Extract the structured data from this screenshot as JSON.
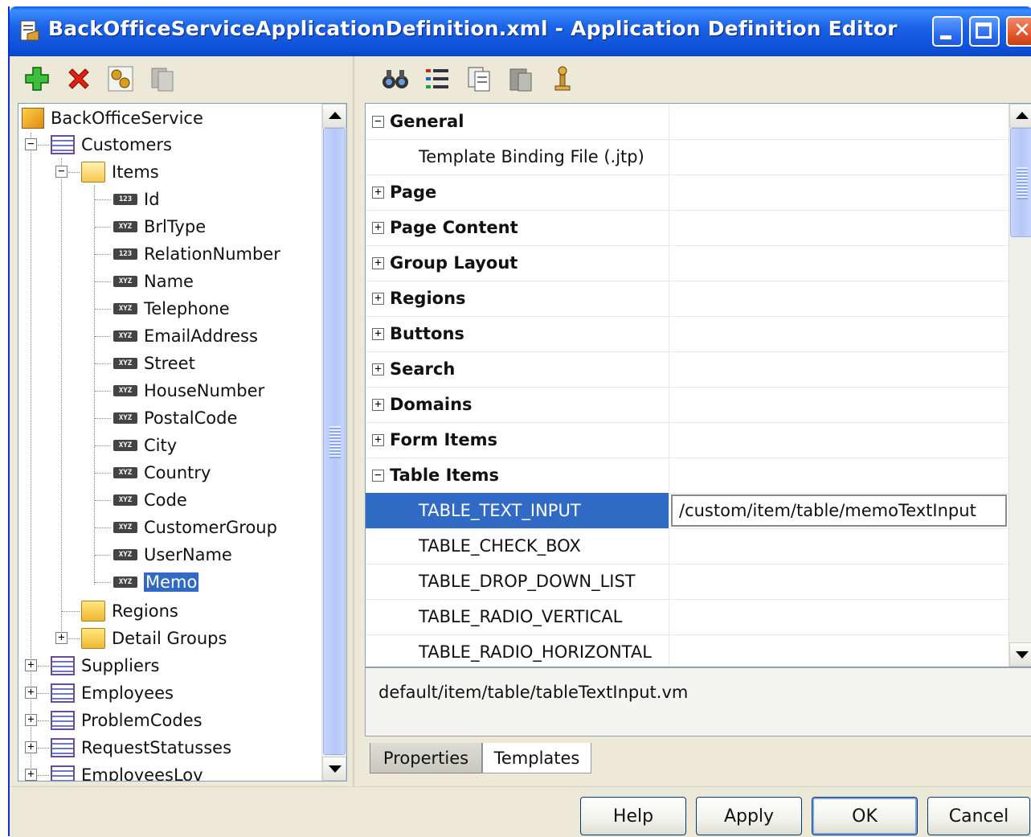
{
  "window": {
    "title": "BackOfficeServiceApplicationDefinition.xml - Application Definition Editor"
  },
  "left_toolbar": {
    "icons": [
      "add-icon",
      "delete-icon",
      "generate-icon",
      "copy-icon"
    ]
  },
  "right_toolbar": {
    "icons": [
      "find-icon",
      "list-icon",
      "copy-icon",
      "paste-icon",
      "pin-icon"
    ]
  },
  "tree": {
    "root": "BackOfficeService",
    "customers": "Customers",
    "items": "Items",
    "fields": [
      "Id",
      "BrlType",
      "RelationNumber",
      "Name",
      "Telephone",
      "EmailAddress",
      "Street",
      "HouseNumber",
      "PostalCode",
      "City",
      "Country",
      "Code",
      "CustomerGroup",
      "UserName",
      "Memo"
    ],
    "field_badges": [
      "123",
      "XYZ",
      "123",
      "XYZ",
      "XYZ",
      "XYZ",
      "XYZ",
      "XYZ",
      "XYZ",
      "XYZ",
      "XYZ",
      "XYZ",
      "XYZ",
      "XYZ",
      "XYZ"
    ],
    "regions": "Regions",
    "detail_groups": "Detail Groups",
    "others": [
      "Suppliers",
      "Employees",
      "ProblemCodes",
      "RequestStatusses",
      "EmployeesLov"
    ],
    "selected": "Memo"
  },
  "properties": {
    "general": "General",
    "template_binding": "Template Binding File (.jtp)",
    "page": "Page",
    "page_content": "Page Content",
    "group_layout": "Group Layout",
    "regions": "Regions",
    "buttons": "Buttons",
    "search": "Search",
    "domains": "Domains",
    "form_items": "Form Items",
    "table_items": "Table Items",
    "table_text_input": "TABLE_TEXT_INPUT",
    "table_text_input_value": "/custom/item/table/memoTextInput",
    "table_check_box": "TABLE_CHECK_BOX",
    "table_drop_down_list": "TABLE_DROP_DOWN_LIST",
    "table_radio_vertical": "TABLE_RADIO_VERTICAL",
    "table_radio_horizontal": "TABLE_RADIO_HORIZONTAL"
  },
  "description": "default/item/table/tableTextInput.vm",
  "tabs": [
    "Properties",
    "Templates"
  ],
  "buttons": {
    "help": "Help",
    "apply": "Apply",
    "ok": "OK",
    "cancel": "Cancel"
  },
  "colors": {
    "title_bar": "#0a5ee8",
    "selection": "#316ac5",
    "dialog_bg": "#ece9d8"
  }
}
